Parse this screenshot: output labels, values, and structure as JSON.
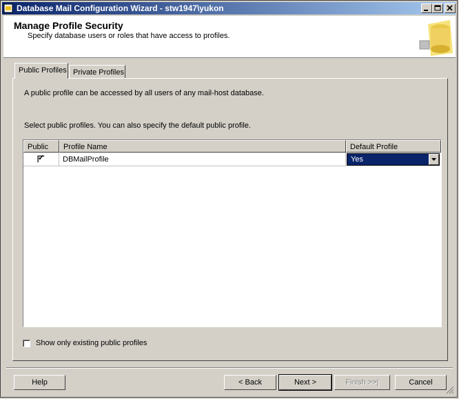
{
  "window": {
    "title": "Database Mail Configuration Wizard - stw1947\\yukon"
  },
  "header": {
    "title": "Manage Profile Security",
    "subtitle": "Specify database users or roles that have access to profiles."
  },
  "tabs": [
    {
      "label": "Public Profiles",
      "active": true
    },
    {
      "label": "Private Profiles",
      "active": false
    }
  ],
  "panel": {
    "description": "A public profile can be accessed by all users of any mail-host database.",
    "instruction": "Select public profiles. You can also specify the default public profile."
  },
  "grid": {
    "columns": [
      "Public",
      "Profile Name",
      "Default Profile"
    ],
    "rows": [
      {
        "public": true,
        "profile_name": "DBMailProfile",
        "default_profile": "Yes"
      }
    ]
  },
  "show_only_existing": {
    "label": "Show only existing public profiles",
    "checked": false
  },
  "buttons": {
    "help": "Help",
    "back": "< Back",
    "next": "Next >",
    "finish": "Finish >>|",
    "cancel": "Cancel"
  },
  "colors": {
    "titlebar_start": "#0a246a",
    "titlebar_end": "#a6caf0",
    "selection": "#0a246a",
    "face": "#d4d0c8"
  },
  "icons": [
    "app-icon",
    "minimize-icon",
    "maximize-icon",
    "close-icon",
    "database-logo-icon",
    "dropdown-arrow-icon",
    "size-grip-icon"
  ]
}
